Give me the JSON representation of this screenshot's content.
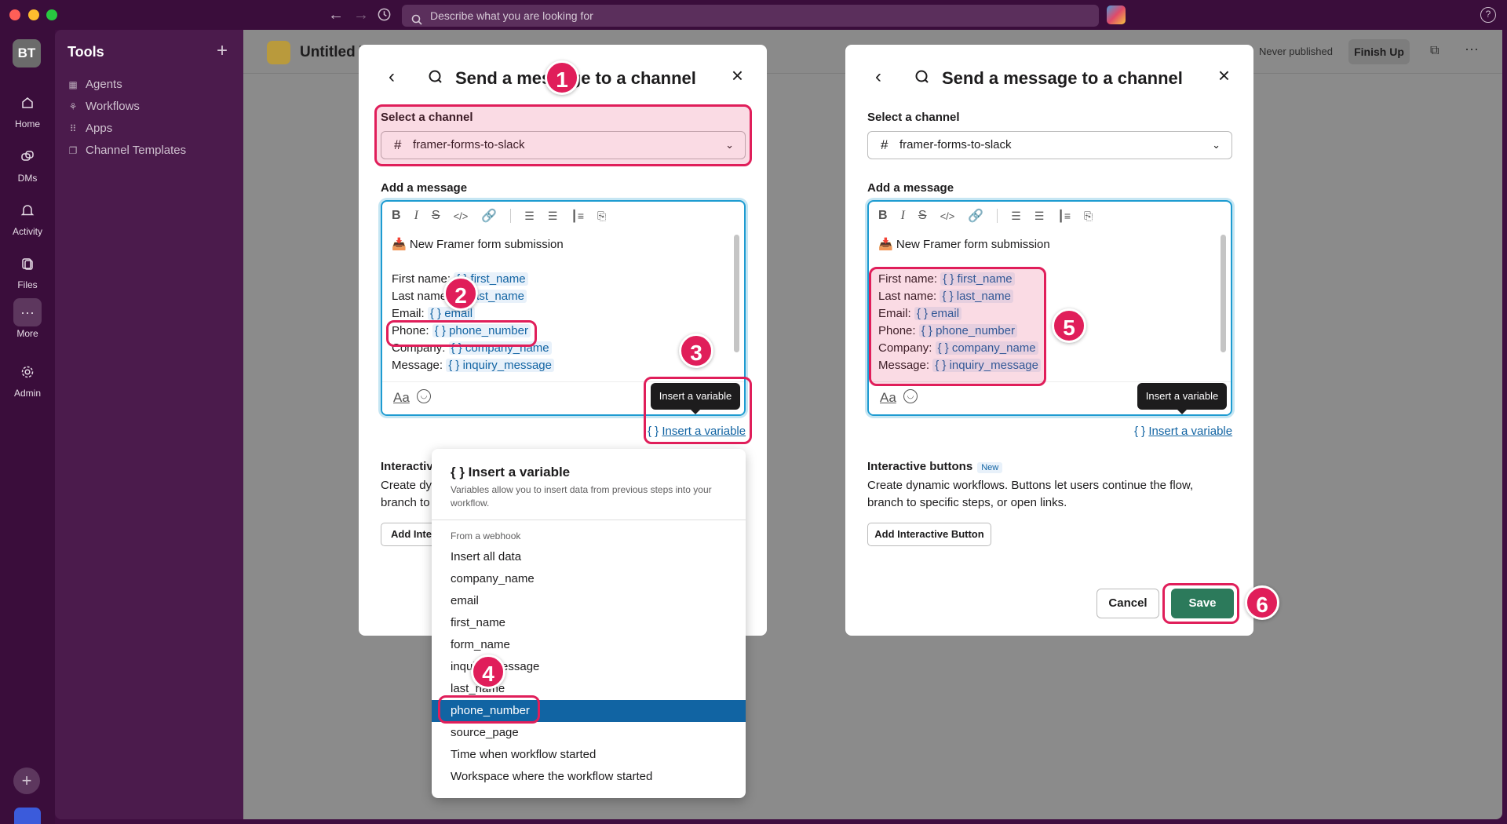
{
  "topbar": {
    "search_placeholder": "Describe what you are looking for",
    "help": "?"
  },
  "rail": {
    "workspace": "BT",
    "items": [
      {
        "label": "Home",
        "icon": "home-icon"
      },
      {
        "label": "DMs",
        "icon": "dms-icon"
      },
      {
        "label": "Activity",
        "icon": "bell-icon"
      },
      {
        "label": "Files",
        "icon": "files-icon"
      },
      {
        "label": "More",
        "icon": "more-icon"
      },
      {
        "label": "Admin",
        "icon": "gear-icon"
      }
    ]
  },
  "sidebar": {
    "title": "Tools",
    "items": [
      {
        "label": "Agents",
        "icon": "agents-icon"
      },
      {
        "label": "Workflows",
        "icon": "workflows-icon"
      },
      {
        "label": "Apps",
        "icon": "apps-icon"
      },
      {
        "label": "Channel Templates",
        "icon": "templates-icon"
      }
    ]
  },
  "main": {
    "title": "Untitled W",
    "status": "Never published",
    "finish_label": "Finish Up"
  },
  "modal": {
    "title": "Send a message to a channel",
    "channel_label": "Select a channel",
    "channel_value": "framer-forms-to-slack",
    "message_label": "Add a message",
    "intro_line": "New Framer form submission",
    "fields": [
      {
        "label": "First name:",
        "var": "{ } first_name"
      },
      {
        "label": "Last name:",
        "var": "{ } last_name"
      },
      {
        "label": "Email:",
        "var": "{ } email"
      },
      {
        "label": "Phone:",
        "var": "{ } phone_number"
      },
      {
        "label": "Company:",
        "var": "{ } company_name"
      },
      {
        "label": "Message:",
        "var": "{ } inquiry_message"
      }
    ],
    "aa_label": "Aa",
    "tooltip": "Insert a variable",
    "insert_icon": "{ }",
    "insert_label": "Insert a variable",
    "ib_title": "Interactive buttons",
    "ib_badge": "New",
    "ib_desc": "Create dynamic workflows. Buttons let users continue the flow, branch to specific steps, or open links.",
    "ib_title_cut": "Interactiv",
    "ib_desc_cut1": "Create dy",
    "ib_desc_cut2": "branch to",
    "add_button": "Add Interactive Button",
    "add_button_cut": "Add Inter",
    "cancel_label": "Cancel",
    "save_label": "Save"
  },
  "dropdown": {
    "title": "{ } Insert a variable",
    "subtitle": "Variables allow you to insert data from previous steps into your workflow.",
    "section": "From a webhook",
    "options": [
      "Insert all data",
      "company_name",
      "email",
      "first_name",
      "form_name",
      "inquiry_message",
      "last_name",
      "phone_number",
      "source_page",
      "Time when workflow started",
      "Workspace where the workflow started"
    ],
    "selected": "phone_number"
  },
  "annotations": [
    "1",
    "2",
    "3",
    "4",
    "5",
    "6"
  ],
  "colors": {
    "accent": "#e01e5a",
    "save": "#2c7a5b",
    "link": "#1264a3",
    "selected": "#1164a3"
  }
}
